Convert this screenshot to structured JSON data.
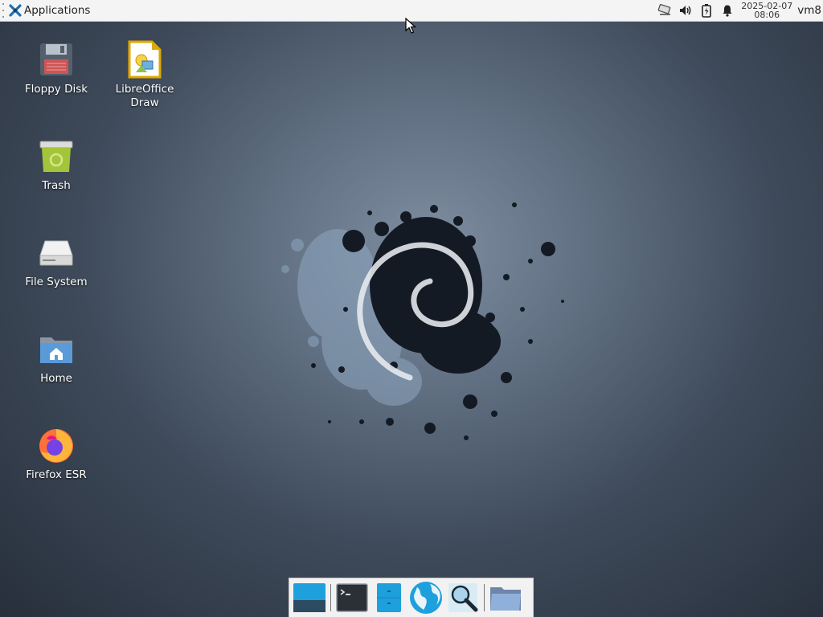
{
  "panel": {
    "applications_label": "Applications",
    "clock": {
      "date": "2025-02-07",
      "time": "08:06"
    },
    "user": "vm8",
    "tray_icons": [
      "network-icon",
      "volume-icon",
      "battery-icon",
      "notification-bell-icon"
    ]
  },
  "desktop": {
    "icons": [
      {
        "label": "Floppy Disk",
        "icon": "floppy-disk-icon"
      },
      {
        "label": "LibreOffice Draw",
        "icon": "libreoffice-draw-icon"
      },
      {
        "label": "Trash",
        "icon": "trash-icon"
      },
      {
        "label": "File System",
        "icon": "hard-drive-icon"
      },
      {
        "label": "Home",
        "icon": "home-folder-icon"
      },
      {
        "label": "Firefox ESR",
        "icon": "firefox-icon"
      }
    ]
  },
  "dock": {
    "items": [
      "show-desktop-icon",
      "terminal-icon",
      "file-manager-icon",
      "web-browser-icon",
      "app-finder-icon",
      "folder-icon"
    ]
  },
  "colors": {
    "panel_bg": "#f4f4f4",
    "wallpaper_center": "#7e8ea0",
    "wallpaper_edge": "#272f3b",
    "accent_blue": "#1ea0dc"
  }
}
